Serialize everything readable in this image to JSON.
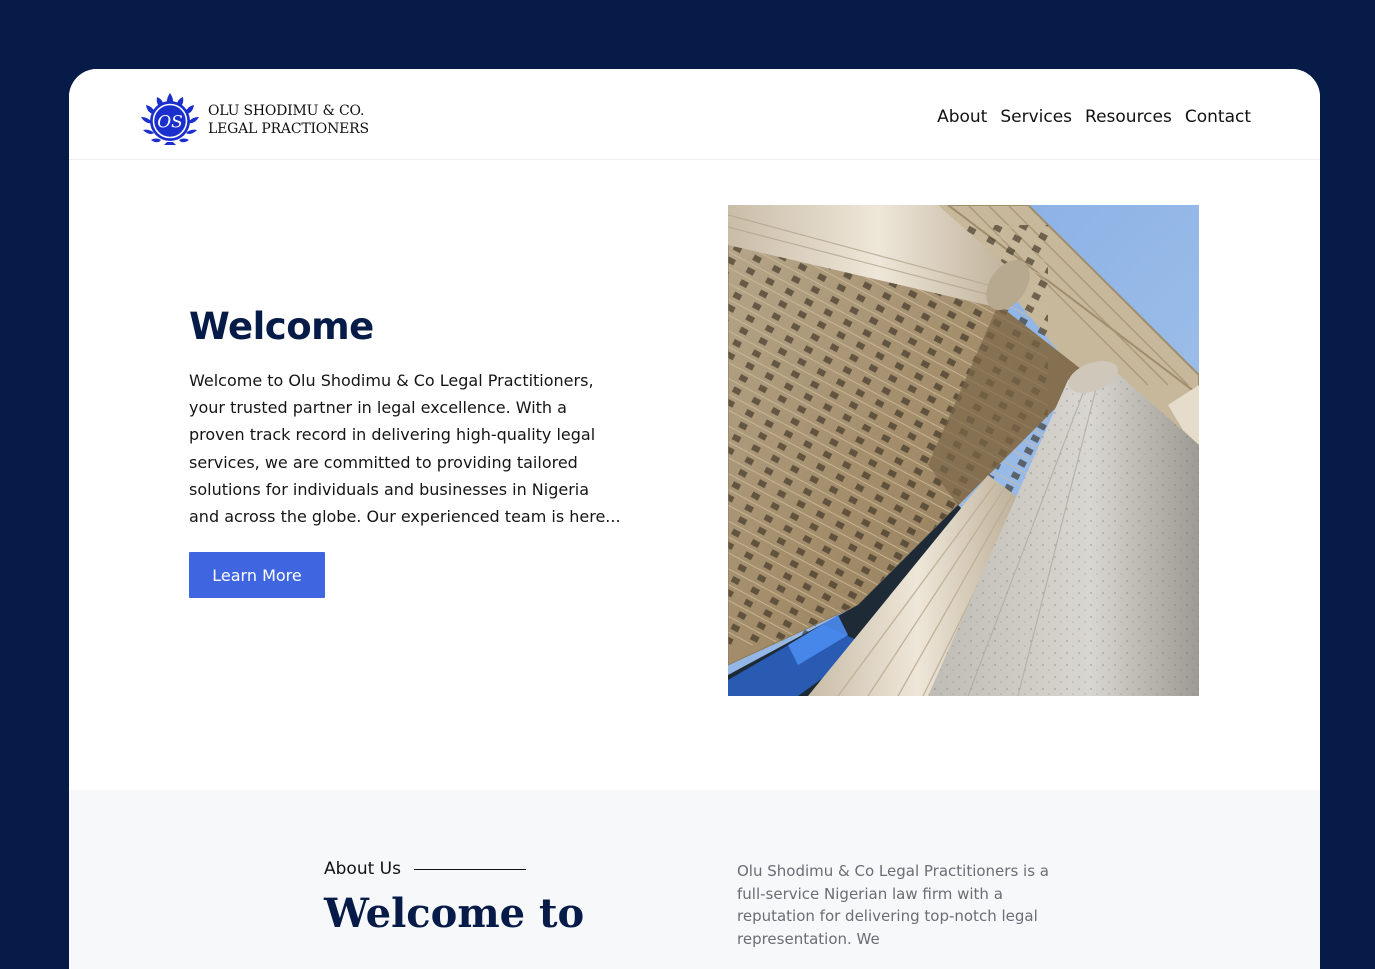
{
  "brand": {
    "name_line1": "Olu Shodimu & Co.",
    "name_line2": "Legal Practioners",
    "monogram": "OS",
    "logo_color": "#1a2fcc"
  },
  "nav": {
    "items": [
      {
        "label": "About"
      },
      {
        "label": "Services"
      },
      {
        "label": "Resources"
      },
      {
        "label": "Contact"
      }
    ]
  },
  "hero": {
    "title": "Welcome",
    "text": "Welcome to Olu Shodimu & Co Legal Practitioners, your trusted partner in legal excellence. With a proven track record in delivering high-quality legal services, we are committed to providing tailored solutions for individuals and businesses in Nigeria and across the globe. Our experienced team is here...",
    "button_label": "Learn More",
    "image_icon": "building-columns-photo"
  },
  "about": {
    "label": "About Us",
    "heading": "Welcome to",
    "text": "Olu Shodimu & Co Legal Practitioners is a full-service Nigerian law firm with a reputation for delivering top-notch legal representation. We"
  },
  "colors": {
    "page_background": "#061b47",
    "heading": "#061b47",
    "accent_button": "#3f66e0",
    "section_background": "#f7f8fa"
  }
}
